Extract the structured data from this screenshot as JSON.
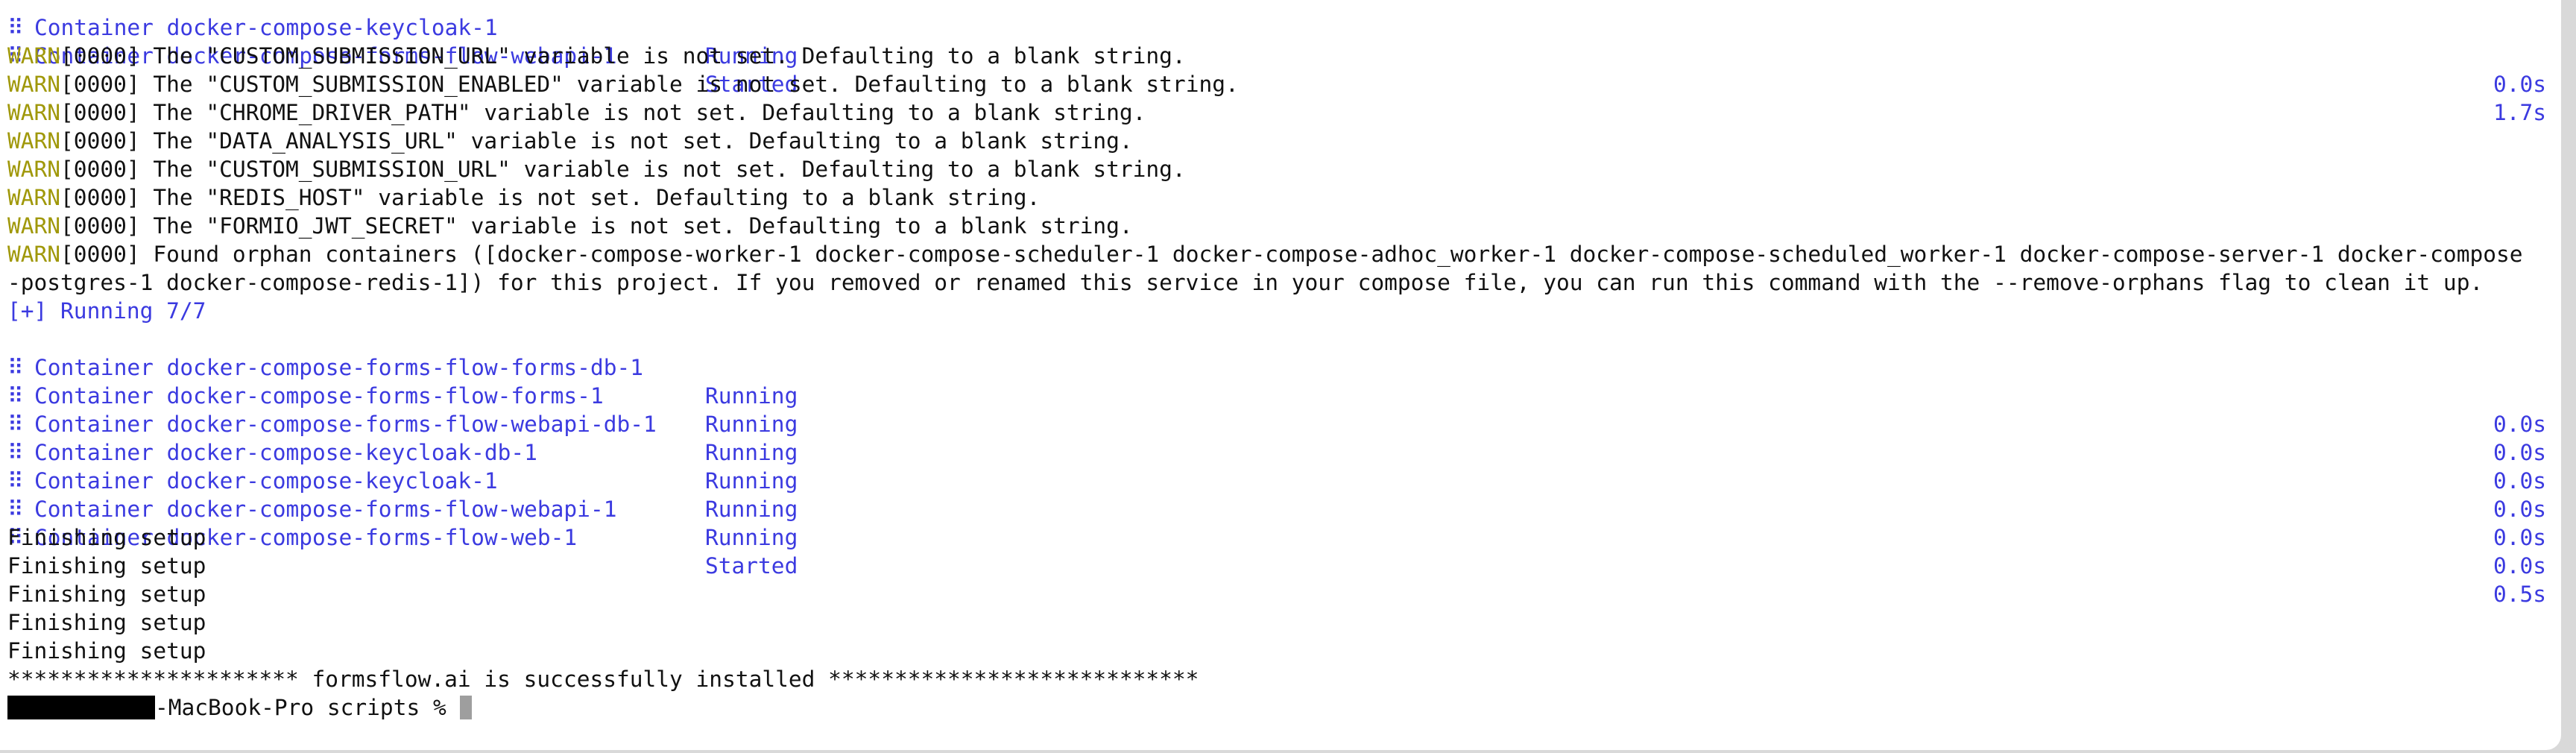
{
  "colors": {
    "warn": "#a0980a",
    "container": "#3b3ae0",
    "text": "#111111",
    "background": "#ffffff"
  },
  "top_rows": [
    {
      "dots": "⠿",
      "name": "Container docker-compose-keycloak-1",
      "status": "Running",
      "time": "0.0s"
    },
    {
      "dots": "⠿",
      "name": "Container docker-compose-forms-flow-webapi-1",
      "status": "Started",
      "time": "1.7s"
    }
  ],
  "warn_prefix": "WARN",
  "warnings": [
    "[0000] The \"CUSTOM_SUBMISSION_URL\" variable is not set. Defaulting to a blank string.",
    "[0000] The \"CUSTOM_SUBMISSION_ENABLED\" variable is not set. Defaulting to a blank string.",
    "[0000] The \"CHROME_DRIVER_PATH\" variable is not set. Defaulting to a blank string.",
    "[0000] The \"DATA_ANALYSIS_URL\" variable is not set. Defaulting to a blank string.",
    "[0000] The \"CUSTOM_SUBMISSION_URL\" variable is not set. Defaulting to a blank string.",
    "[0000] The \"REDIS_HOST\" variable is not set. Defaulting to a blank string.",
    "[0000] The \"FORMIO_JWT_SECRET\" variable is not set. Defaulting to a blank string."
  ],
  "orphan_warning_line1": "[0000] Found orphan containers ([docker-compose-worker-1 docker-compose-scheduler-1 docker-compose-adhoc_worker-1 docker-compose-scheduled_worker-1 docker-compose-server-1 docker-compose",
  "orphan_warning_line2": "-postgres-1 docker-compose-redis-1]) for this project. If you removed or renamed this service in your compose file, you can run this command with the --remove-orphans flag to clean it up.",
  "running_header": "[+] Running 7/7",
  "containers": [
    {
      "dots": "⠿",
      "name": "Container docker-compose-forms-flow-forms-db-1",
      "status": "Running",
      "time": "0.0s"
    },
    {
      "dots": "⠿",
      "name": "Container docker-compose-forms-flow-forms-1",
      "status": "Running",
      "time": "0.0s"
    },
    {
      "dots": "⠿",
      "name": "Container docker-compose-forms-flow-webapi-db-1",
      "status": "Running",
      "time": "0.0s"
    },
    {
      "dots": "⠿",
      "name": "Container docker-compose-keycloak-db-1",
      "status": "Running",
      "time": "0.0s"
    },
    {
      "dots": "⠿",
      "name": "Container docker-compose-keycloak-1",
      "status": "Running",
      "time": "0.0s"
    },
    {
      "dots": "⠿",
      "name": "Container docker-compose-forms-flow-webapi-1",
      "status": "Running",
      "time": "0.0s"
    },
    {
      "dots": "⠿",
      "name": "Container docker-compose-forms-flow-web-1",
      "status": "Started",
      "time": "0.5s"
    }
  ],
  "finishing": [
    "Finishing setup",
    "Finishing setup",
    "Finishing setup",
    "Finishing setup",
    "Finishing setup"
  ],
  "success_line": "********************** formsflow.ai is successfully installed ****************************",
  "prompt": {
    "host_suffix": "-MacBook-Pro scripts % "
  }
}
